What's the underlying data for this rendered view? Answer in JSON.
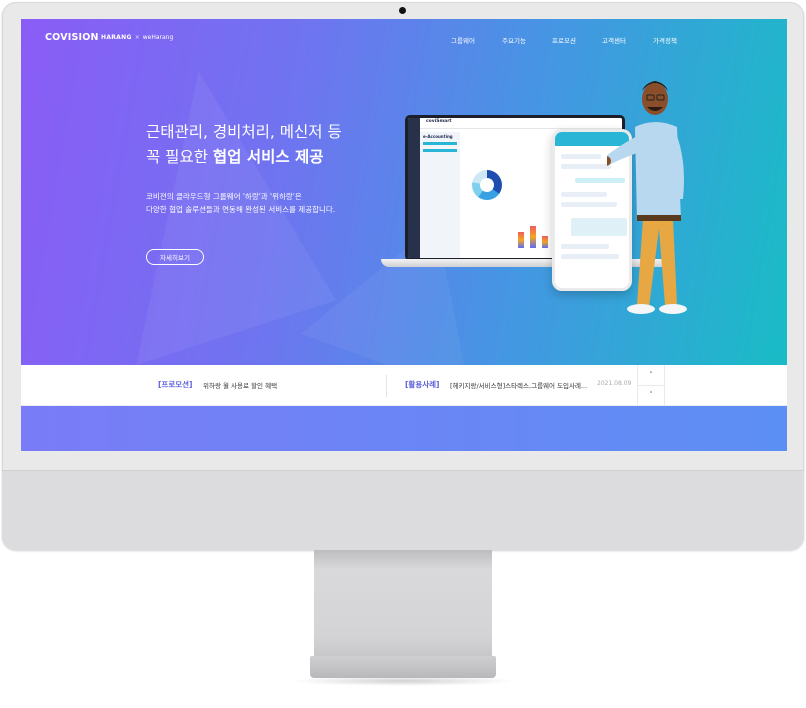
{
  "header": {
    "logo": "COVISION",
    "partner1": "HARANG",
    "partner_sep": "×",
    "partner2": "weHarang",
    "menu": [
      "그룹웨어",
      "주요기능",
      "프로모션",
      "고객센터",
      "가격정책"
    ]
  },
  "hero": {
    "headline_line1": "근태관리, 경비처리, 메신저 등",
    "headline_line2_prefix": "꼭 필요한 ",
    "headline_line2_bold": "협업 서비스 제공",
    "desc_line1": "코비젼의 클라우드형 그룹웨어 '하랑'과 '위하랑'은",
    "desc_line2": "다양한 협업 솔루션들과 연동해 완성된 서비스를 제공합니다.",
    "cta": "자세히보기"
  },
  "mockup": {
    "app_brand": "coviSmart",
    "app_module": "e-Accounting"
  },
  "notice": {
    "left_tag": "[프로모션]",
    "left_text": "위하랑 월 사용료 할인 혜택",
    "right_tag": "[활용사례]",
    "right_text": "[헤키지랑/서비스형]스타렉스,그룹웨어 도입사례...",
    "right_date": "2021.08.09",
    "up_icon": "˄",
    "down_icon": "˅"
  },
  "colors": {
    "hero_start": "#8a5cf6",
    "hero_end": "#19bcc6",
    "tag": "#5b5fd8",
    "bottom_band": "#6b84f6"
  }
}
